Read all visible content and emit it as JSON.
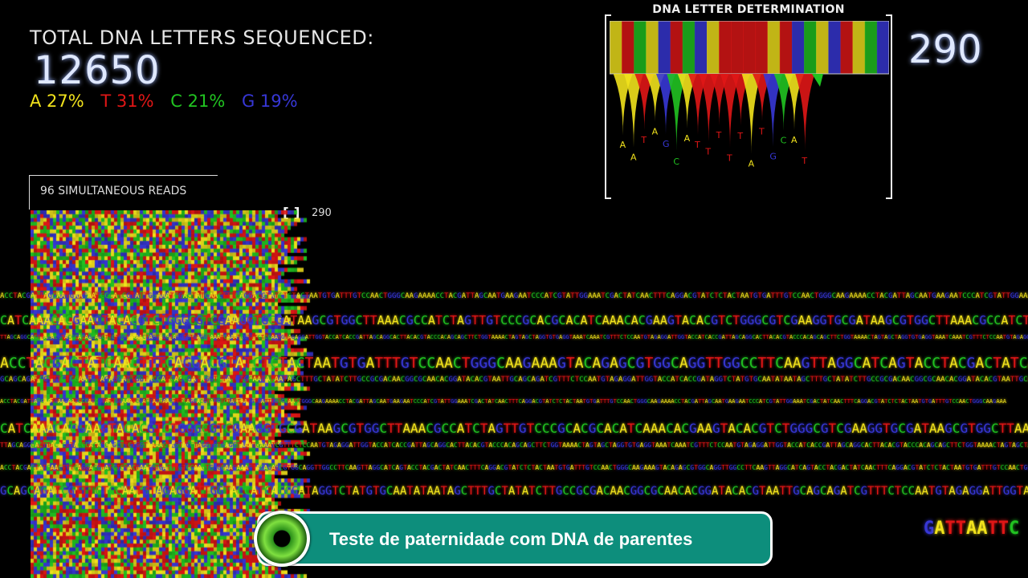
{
  "header": {
    "total_label": "TOTAL DNA LETTERS SEQUENCED:",
    "total_count": "12650",
    "percentages": [
      {
        "label": "A 27%",
        "base": "A",
        "color": "#f1e21c"
      },
      {
        "label": "T 31%",
        "base": "T",
        "color": "#e01616"
      },
      {
        "label": "C 21%",
        "base": "C",
        "color": "#21c321"
      },
      {
        "label": "G 19%",
        "base": "G",
        "color": "#3737d6"
      }
    ]
  },
  "determination": {
    "title": "DNA LETTER DETERMINATION",
    "count": "290",
    "called_letters": [
      "A",
      "A",
      "T",
      "A",
      "G",
      "C",
      "A",
      "T",
      "T",
      "T",
      "T",
      "T",
      "A",
      "T",
      "G",
      "C",
      "A",
      "T"
    ]
  },
  "reads": {
    "title": "96 SIMULTANEOUS READS",
    "count": "290"
  },
  "sequence_lines": [
    "ACCTACGATTAGCAATGAAGAATCCCATCGTATTGGAAATCGACTATCAACTTTCAGGACGTATCTCTACTAATGTGATTTGTCCAACTGGGCAAGAAA",
    "CATCAAACACGAAGTACACGTCTGGGCGTCGAAGGTGCGATAAGCGTGGCTTAAACGCCATCTAGTTGTCCCGCACGCA",
    "TTAGCAGGCACTTACACGTACCCACAGCAGCTTCTGGTAAAACTAGTAGCTAGGTGTGAGGTAAATCAAATCGTTTCTCCAATGTAGAGGATTGGTACCATCACCGA",
    "ACCTACGACTATCAACTTTCAGGACGTATCTCTACTAATGTGATTTGTCCAACTGGGCAAGAAAGTACAGAGCGTGGCAGGTTGGCCTTCAAGTTAGGCATCAGT",
    "GCAGCAGATCGTTTCTCCAATGTAGAGGATTGGTACCATCACCGATAGGTCTATGTGCAATATAATAGCTTTGCTATATCTTGCCGCGACAACGGCGCAACACGGATACACGTAATT"
  ],
  "banner": {
    "text": "Teste de paternidade com DNA de parentes"
  },
  "tail_sequence": "GATTAATTC",
  "icons": {
    "logo": "green-eye-logo-icon"
  }
}
